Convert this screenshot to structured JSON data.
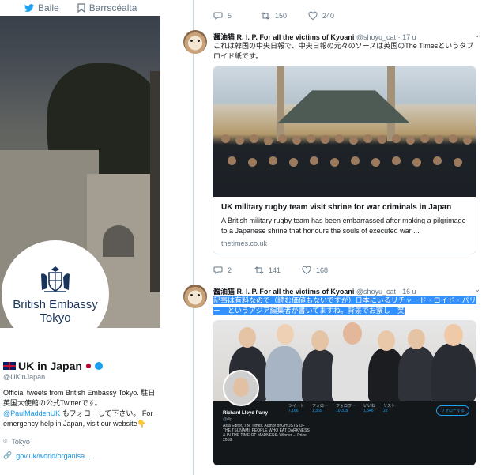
{
  "nav": {
    "home_label": "Baile",
    "moments_label": "Barrscéalta"
  },
  "profile": {
    "avatar_line1": "British Embassy",
    "avatar_line2": "Tokyo",
    "name": "UK in Japan",
    "handle": "@UKinJapan",
    "bio_part1": "Official tweets from British Embassy Tokyo. 駐日英国大使館の公式Twitterです。",
    "bio_mention": "@PaulMaddenUK",
    "bio_part2": " もフォローして下さい。 For emergency help in Japan, visit our website👇",
    "location": "Tokyo",
    "website": "gov.uk/world/organisa..."
  },
  "tweets": [
    {
      "actions": {
        "replies": "5",
        "retweets": "150",
        "likes": "240"
      }
    },
    {
      "author": "醤油猫 R. I. P. For all the victims of Kyoani",
      "handle": "@shoyu_cat",
      "time": "· 17 u",
      "text": "これは韓国の中央日報で、中央日報の元々のソースは英国のThe Timesというタブロイド紙です。",
      "card": {
        "title": "UK military rugby team visit shrine for war criminals in Japan",
        "description": "A British military rugby team has been embarrassed after making a pilgrimage to a Japanese shrine that honours the souls of executed war ...",
        "domain": "thetimes.co.uk"
      },
      "actions": {
        "replies": "2",
        "retweets": "141",
        "likes": "168"
      }
    },
    {
      "author": "醤油猫 R. I. P. For all the victims of Kyoani",
      "handle": "@shoyu_cat",
      "time": "· 16 u",
      "text": "記事は有料なので（読む価値もないですが）日本にいるリチャード・ロイド・パリー　というアジア編集者が書いてますね。背景でお察し　笑",
      "card": {
        "profile_name": "Richard Lloyd Parry",
        "profile_handle": "@rllp",
        "profile_bio": "Asia Editor, The Times. Author of GHOSTS OF THE TSUNAMI: PEOPLE WHO EAT DARKNESS & IN THE TIME OF MADNESS. Winner ... Prize 2018.",
        "stats": [
          {
            "label": "ツイート",
            "value": "7,166"
          },
          {
            "label": "フォロー",
            "value": "1,365"
          },
          {
            "label": "フォロワー",
            "value": "10,318"
          },
          {
            "label": "いいね",
            "value": "1,546"
          },
          {
            "label": "リスト",
            "value": "22"
          }
        ],
        "follow_label": "フォローする"
      }
    }
  ]
}
